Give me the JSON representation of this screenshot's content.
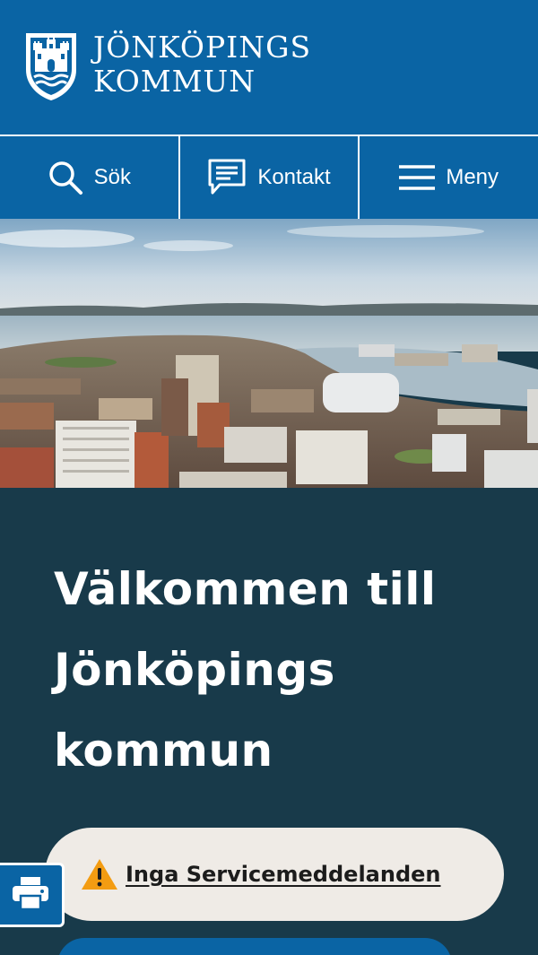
{
  "header": {
    "logo_line1": "JÖNKÖPINGS",
    "logo_line2": "KOMMUN",
    "crest_icon": "castle-crest-icon",
    "background_color": "#0a64a4"
  },
  "nav": {
    "items": [
      {
        "label": "Sök",
        "icon": "search-icon"
      },
      {
        "label": "Kontakt",
        "icon": "chat-icon"
      },
      {
        "label": "Meny",
        "icon": "hamburger-menu-icon"
      }
    ]
  },
  "hero": {
    "icon": "aerial-city-photo"
  },
  "welcome": {
    "line1": "Välkommen till",
    "line2": "Jönköpings",
    "line3": "kommun"
  },
  "service": {
    "label": "Inga Servicemeddelanden",
    "icon": "warning-icon",
    "icon_color": "#f39c12"
  },
  "print": {
    "icon": "printer-icon"
  },
  "colors": {
    "primary_blue": "#0a64a4",
    "dark_teal": "#183a4a",
    "pill_bg": "#efebe6"
  }
}
